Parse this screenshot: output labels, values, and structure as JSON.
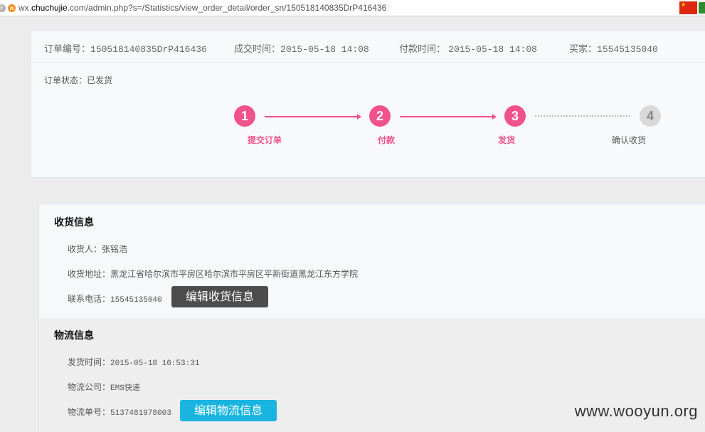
{
  "browser": {
    "url_prefix": "wx.",
    "url_domain": "chuchujie",
    "url_suffix": ".com/admin.php?s=/Statistics/view_order_detail/order_sn/150518140835DrP416436"
  },
  "order": {
    "sn_label": "订单编号：",
    "sn_value": "150518140835DrP416436",
    "deal_label": "成交时间：",
    "deal_value": "2015-05-18 14:08",
    "pay_label": "付款时间：",
    "pay_value": "2015-05-18 14:08",
    "buyer_label": "买家：",
    "buyer_value": "15545135040",
    "status_label": "订单状态：",
    "status_value": "已发货"
  },
  "steps": [
    {
      "num": "1",
      "label": "提交订单",
      "state": "done"
    },
    {
      "num": "2",
      "label": "付款",
      "state": "done"
    },
    {
      "num": "3",
      "label": "发货",
      "state": "done"
    },
    {
      "num": "4",
      "label": "确认收货",
      "state": "todo"
    }
  ],
  "receive": {
    "title": "收货信息",
    "name_label": "收货人：",
    "name_value": "张铭浩",
    "addr_label": "收货地址：",
    "addr_value": "黑龙江省哈尔滨市平房区哈尔滨市平房区平新街道黑龙江东方学院",
    "phone_label": "联系电话：",
    "phone_value": "15545135040",
    "edit_button": "编辑收货信息"
  },
  "logistics": {
    "title": "物流信息",
    "time_label": "发货时间：",
    "time_value": "2015-05-18 16:53:31",
    "company_label": "物流公司：",
    "company_value": "EMS快递",
    "no_label": "物流单号：",
    "no_value": "5137481978003",
    "edit_button": "编辑物流信息"
  },
  "watermark": "www.wooyun.org",
  "colors": {
    "accent": "#f0528a",
    "dark_button": "#4d4d4d",
    "blue_button": "#19b5e0"
  }
}
